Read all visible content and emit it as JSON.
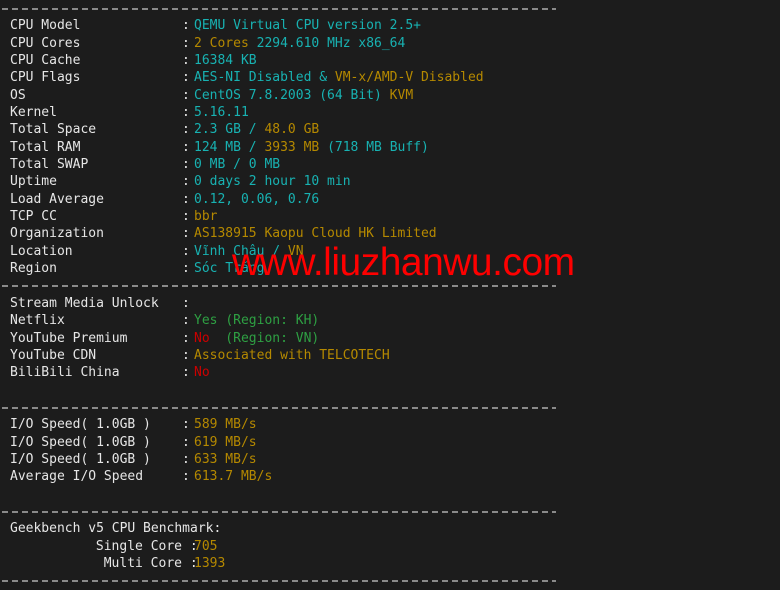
{
  "terminal": {
    "background": "#1c1c1c",
    "label_color": "#e6e6e6",
    "cyan": "#18b2b2",
    "yellow": "#b58900",
    "green": "#2ea043",
    "red": "#cc0000",
    "separator_color": "#8a8a8a",
    "colon": ":"
  },
  "watermark": {
    "text": "www.liuzhanwu.com",
    "color": "#fe0000"
  },
  "system_info": {
    "rows": [
      {
        "label": "CPU Model",
        "value_cyan": "QEMU Virtual CPU version 2.5+",
        "value_yellow": ""
      },
      {
        "label": "CPU Cores",
        "value_cyan": "",
        "value_yellow": "2 Cores",
        "value_cyan_2": "2294.610 MHz x86_64"
      },
      {
        "label": "CPU Cache",
        "value_cyan": "16384 KB",
        "value_yellow": ""
      },
      {
        "label": "CPU Flags",
        "value_cyan": "AES-NI Disabled &",
        "value_yellow": "VM-x/AMD-V Disabled"
      },
      {
        "label": "OS",
        "value_cyan": "CentOS 7.8.2003 (64 Bit)",
        "value_yellow": "KVM"
      },
      {
        "label": "Kernel",
        "value_cyan": "5.16.11",
        "value_yellow": ""
      },
      {
        "label": "Total Space",
        "value_cyan": "2.3 GB /",
        "value_yellow": "48.0 GB"
      },
      {
        "label": "Total RAM",
        "value_cyan": "124 MB /",
        "value_yellow": "3933 MB",
        "value_cyan_2": "(718 MB Buff)"
      },
      {
        "label": "Total SWAP",
        "value_cyan": "0 MB /",
        "value_yellow": "0 MB"
      },
      {
        "label": "Uptime",
        "value_cyan": "0 days 2 hour 10 min",
        "value_yellow": ""
      },
      {
        "label": "Load Average",
        "value_cyan": "0.12, 0.06, 0.76",
        "value_yellow": ""
      },
      {
        "label": "TCP CC",
        "value_cyan": "",
        "value_yellow": "bbr"
      },
      {
        "label": "Organization",
        "value_cyan": "",
        "value_yellow": "AS138915 Kaopu Cloud HK Limited"
      },
      {
        "label": "Location",
        "value_cyan": "Vĩnh Châu /",
        "value_yellow": "VN"
      },
      {
        "label": "Region",
        "value_cyan": "Sóc Trăng",
        "value_yellow": ""
      }
    ]
  },
  "stream_unlock": {
    "header_label": "Stream Media Unlock",
    "header_value": "",
    "rows": [
      {
        "label": "Netflix",
        "status": "Yes",
        "status_color": "green",
        "region": "(Region: KH)",
        "region_color": "green"
      },
      {
        "label": "YouTube Premium",
        "status": "No",
        "status_color": "red",
        "region": " (Region: VN)",
        "region_color": "green"
      },
      {
        "label": "YouTube CDN",
        "status": "Associated with TELCOTECH",
        "status_color": "yellow",
        "region": "",
        "region_color": ""
      },
      {
        "label": "BiliBili China",
        "status": "No",
        "status_color": "red",
        "region": "",
        "region_color": ""
      }
    ]
  },
  "io_speed": {
    "rows": [
      {
        "label": "I/O Speed( 1.0GB )",
        "value": "589 MB/s"
      },
      {
        "label": "I/O Speed( 1.0GB )",
        "value": "619 MB/s"
      },
      {
        "label": "I/O Speed( 1.0GB )",
        "value": "633 MB/s"
      },
      {
        "label": "Average I/O Speed",
        "value": "613.7 MB/s"
      }
    ]
  },
  "geekbench": {
    "title": "Geekbench v5 CPU Benchmark:",
    "rows": [
      {
        "label": "Single Core",
        "value": "705"
      },
      {
        "label": "Multi Core",
        "value": "1393"
      }
    ]
  }
}
